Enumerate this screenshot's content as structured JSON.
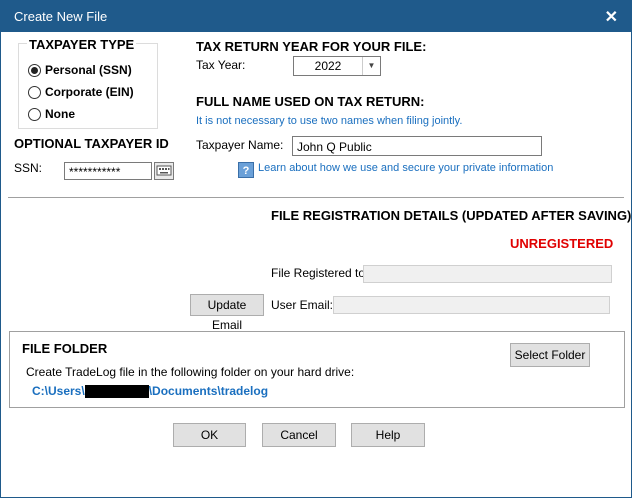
{
  "window": {
    "title": "Create New File",
    "close_glyph": "✕"
  },
  "taxpayer_type": {
    "heading": "TAXPAYER TYPE",
    "options": [
      {
        "label": "Personal (SSN)",
        "selected": true
      },
      {
        "label": "Corporate (EIN)",
        "selected": false
      },
      {
        "label": "None",
        "selected": false
      }
    ]
  },
  "optional_id": {
    "heading": "OPTIONAL TAXPAYER ID",
    "ssn_label": "SSN:",
    "ssn_value": "***********",
    "toggle_icon": "keyboard-icon"
  },
  "tax_year": {
    "heading": "TAX RETURN YEAR FOR YOUR FILE:",
    "label": "Tax Year:",
    "value": "2022"
  },
  "full_name": {
    "heading": "FULL NAME USED ON TAX RETURN:",
    "note": "It is not necessary to use two names when filing jointly.",
    "label": "Taxpayer Name:",
    "value": "John Q Public",
    "help_icon": "question-icon",
    "help_link": "Learn about how we use and secure your private information"
  },
  "registration": {
    "heading": "FILE REGISTRATION DETAILS (UPDATED AFTER SAVING)",
    "status": "UNREGISTERED",
    "registered_to_label": "File Registered to:",
    "registered_to_value": "",
    "update_email_label": "Update Email",
    "email_label": "User Email:",
    "email_value": ""
  },
  "file_folder": {
    "heading": "FILE FOLDER",
    "description": "Create TradeLog file in the following folder on your hard drive:",
    "path_prefix": "C:\\Users\\",
    "path_suffix": "\\Documents\\tradelog",
    "select_label": "Select Folder"
  },
  "buttons": {
    "ok": "OK",
    "cancel": "Cancel",
    "help": "Help"
  },
  "colors": {
    "titlebar": "#1f5a8b",
    "accent_blue": "#1a6fbf",
    "status_red": "#e00000"
  }
}
